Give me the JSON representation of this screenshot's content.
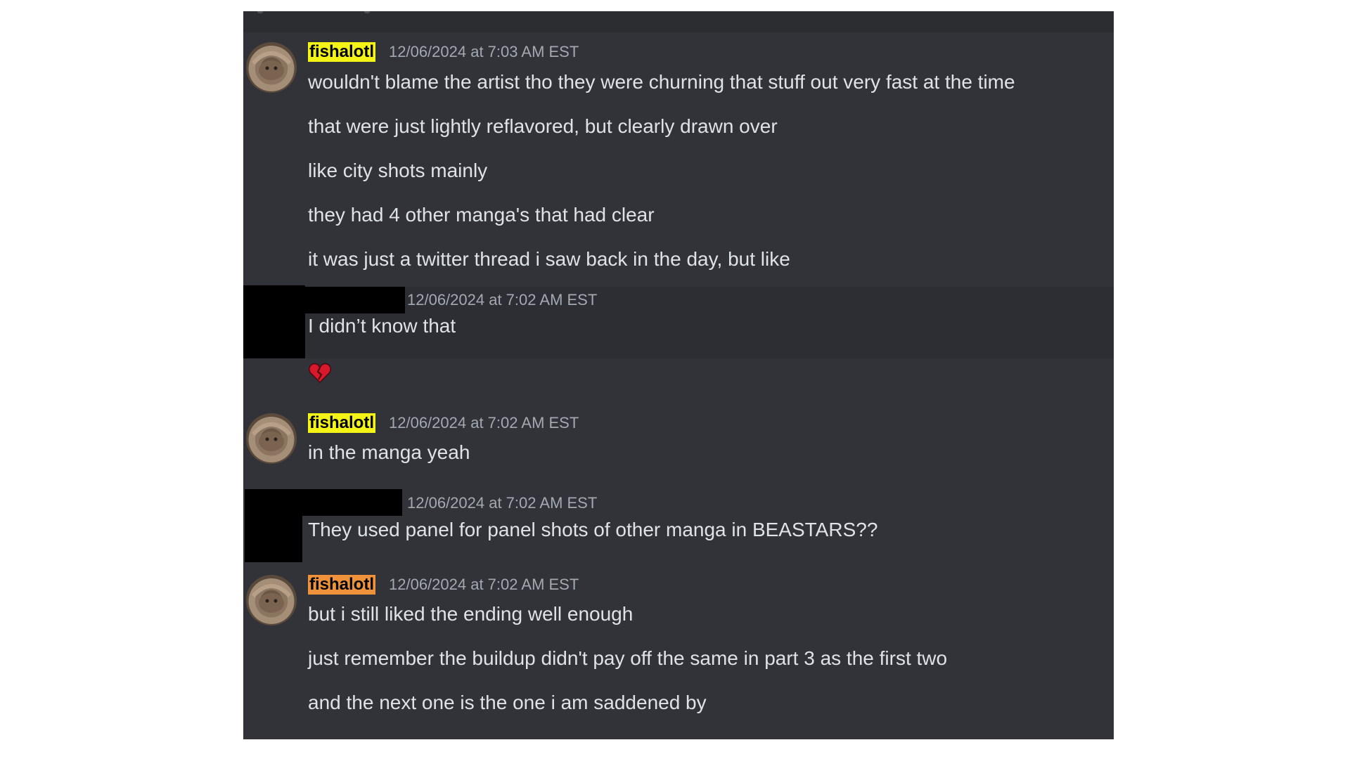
{
  "messages": [
    {
      "username": "fishalotl",
      "timestamp": "12/06/2024 at 7:03 AM EST",
      "lines": [
        "wouldn't blame the artist tho they were churning that stuff out very fast at the time",
        "that were just lightly reflavored, but clearly drawn over",
        "like city shots mainly",
        "they had 4 other manga's that had clear",
        "it was just a twitter thread i saw back in the day, but like"
      ]
    },
    {
      "username": "",
      "timestamp": "12/06/2024 at 7:02 AM EST",
      "lines": [
        "I didn’t know that"
      ],
      "reaction_icon": "broken-heart-icon"
    },
    {
      "username": "fishalotl",
      "timestamp": "12/06/2024 at 7:02 AM EST",
      "lines": [
        "in the manga yeah"
      ]
    },
    {
      "username": "",
      "timestamp": "12/06/2024 at 7:02 AM EST",
      "lines": [
        "They used panel for panel shots of other manga in BEASTARS??"
      ]
    },
    {
      "username": "fishalotl",
      "timestamp": "12/06/2024 at 7:02 AM EST",
      "lines": [
        "but i still liked the ending well enough",
        "just remember the buildup didn't pay off the same in part 3 as the first two",
        "and the next one is the one i am saddened by"
      ]
    }
  ],
  "colors": {
    "background": "#313338",
    "highlight_row": "#2c2e33",
    "text": "#dfe2e7",
    "timestamp": "#a4a8b0",
    "username_yellow_bg": "#f3f315",
    "username_orange_bg": "#f0923a",
    "redaction": "#000000"
  }
}
